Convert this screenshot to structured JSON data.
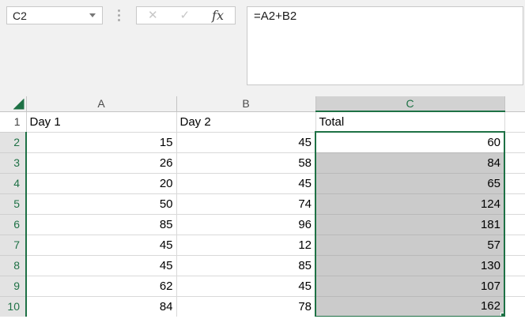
{
  "name_box": {
    "value": "C2"
  },
  "formula_bar": {
    "value": "=A2+B2"
  },
  "icons": {
    "cancel": "✕",
    "enter": "✓",
    "function": "fx"
  },
  "colors": {
    "accent_green": "#1E7145",
    "selection_fill": "#CBCBCB",
    "selected_header_fill": "#D2D2D2"
  },
  "sheet": {
    "column_headers": [
      "A",
      "B",
      "C"
    ],
    "selected_column": "C",
    "selected_range": "C2:C10",
    "active_cell": "C2",
    "rows": [
      {
        "header": "1",
        "cells": [
          "Day 1",
          "Day 2",
          "Total"
        ],
        "in_selection": false
      },
      {
        "header": "2",
        "cells": [
          "15",
          "45",
          "60"
        ],
        "in_selection": true
      },
      {
        "header": "3",
        "cells": [
          "26",
          "58",
          "84"
        ],
        "in_selection": true
      },
      {
        "header": "4",
        "cells": [
          "20",
          "45",
          "65"
        ],
        "in_selection": true
      },
      {
        "header": "5",
        "cells": [
          "50",
          "74",
          "124"
        ],
        "in_selection": true
      },
      {
        "header": "6",
        "cells": [
          "85",
          "96",
          "181"
        ],
        "in_selection": true
      },
      {
        "header": "7",
        "cells": [
          "45",
          "12",
          "57"
        ],
        "in_selection": true
      },
      {
        "header": "8",
        "cells": [
          "45",
          "85",
          "130"
        ],
        "in_selection": true
      },
      {
        "header": "9",
        "cells": [
          "62",
          "45",
          "107"
        ],
        "in_selection": true
      },
      {
        "header": "10",
        "cells": [
          "84",
          "78",
          "162"
        ],
        "in_selection": true
      }
    ]
  }
}
